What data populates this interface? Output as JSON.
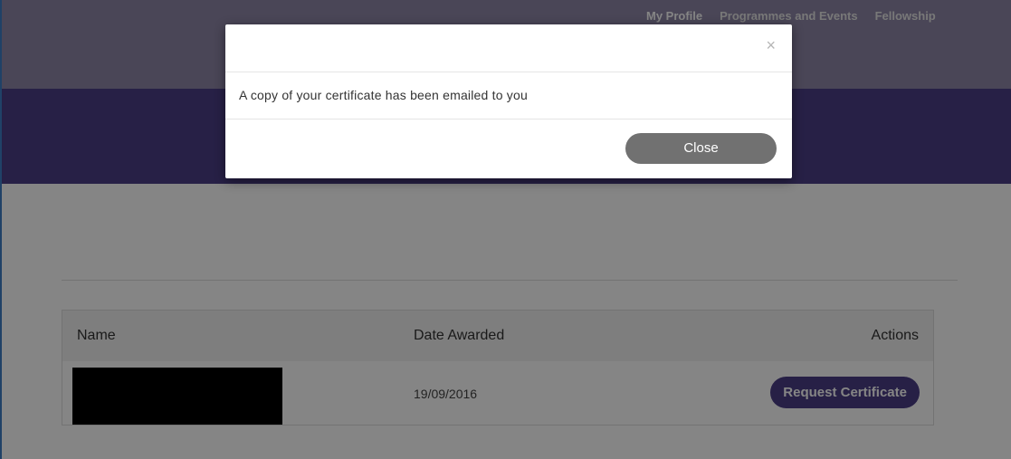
{
  "nav": {
    "items": [
      {
        "label": "My Profile"
      },
      {
        "label": "Programmes and Events"
      },
      {
        "label": "Fellowship"
      }
    ]
  },
  "table": {
    "headers": {
      "name": "Name",
      "date_awarded": "Date Awarded",
      "actions": "Actions"
    },
    "rows": [
      {
        "date_awarded": "19/09/2016",
        "action_label": "Request Certificate"
      }
    ]
  },
  "modal": {
    "close_icon": "×",
    "message": "A copy of your certificate has been emailed to you",
    "close_button_label": "Close"
  },
  "colors": {
    "brand_purple": "#4b3f86",
    "modal_button_gray": "#717171"
  }
}
